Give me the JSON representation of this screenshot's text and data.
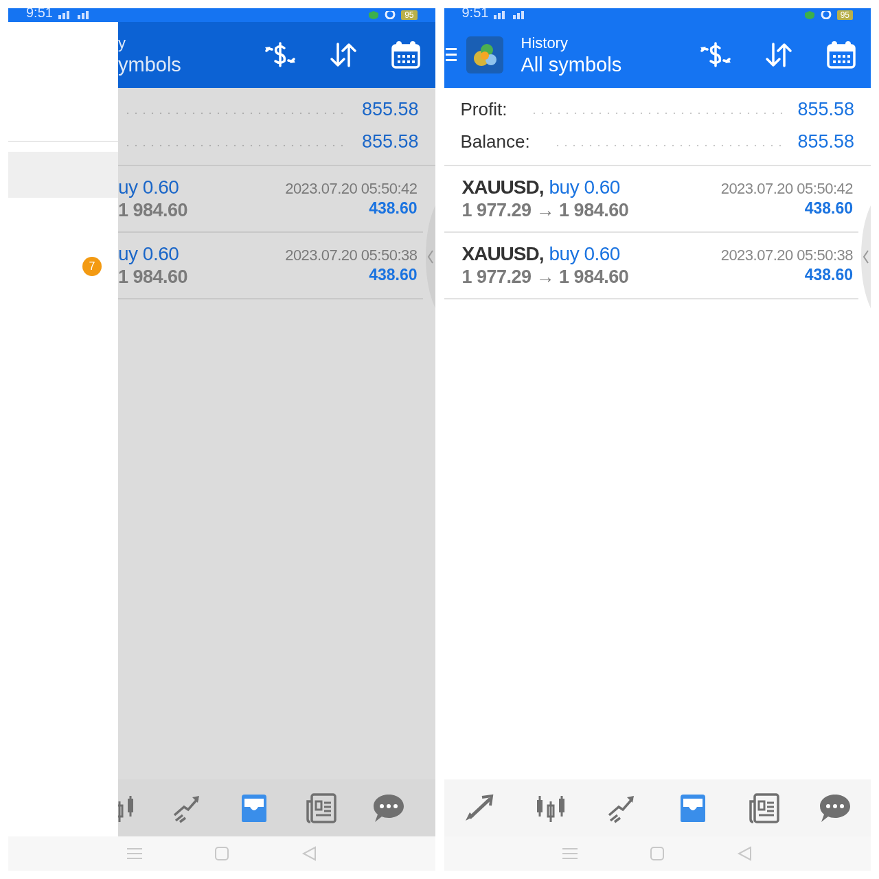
{
  "panels": [
    {
      "dimmed": true,
      "status_bar": {
        "time": "9:51",
        "battery": "95"
      },
      "drawer": {
        "badge": "7"
      },
      "header": {
        "title": "y",
        "subtitle": "ymbols"
      },
      "summary": [
        {
          "value": "855.58"
        },
        {
          "value": "855.58"
        }
      ],
      "deals": [
        {
          "side": "uy 0.60",
          "prices": "1 984.60",
          "time": "2023.07.20 05:50:42",
          "profit": "438.60"
        },
        {
          "side": "uy 0.60",
          "prices": "1 984.60",
          "time": "2023.07.20 05:50:38",
          "profit": "438.60"
        }
      ],
      "nav": [
        {
          "kind": "candles",
          "selected": false,
          "cut": true
        },
        {
          "kind": "chart",
          "selected": false
        },
        {
          "kind": "inbox",
          "selected": true
        },
        {
          "kind": "news",
          "selected": false
        },
        {
          "kind": "chat",
          "selected": false
        }
      ]
    },
    {
      "dimmed": false,
      "status_bar": {
        "time": "9:51",
        "battery": "95"
      },
      "header": {
        "menu": true,
        "logo": true,
        "title": "History",
        "subtitle": "All symbols"
      },
      "summary": [
        {
          "label": "Profit:",
          "value": "855.58"
        },
        {
          "label": "Balance:",
          "value": "855.58"
        }
      ],
      "deals": [
        {
          "symbol": "XAUUSD,",
          "side": "buy 0.60",
          "prices": "1 977.29 → 1 984.60",
          "time": "2023.07.20 05:50:42",
          "profit": "438.60"
        },
        {
          "symbol": "XAUUSD,",
          "side": "buy 0.60",
          "prices": "1 977.29 → 1 984.60",
          "time": "2023.07.20 05:50:38",
          "profit": "438.60"
        }
      ],
      "nav": [
        {
          "kind": "trade",
          "selected": false
        },
        {
          "kind": "candles",
          "selected": false
        },
        {
          "kind": "chart",
          "selected": false
        },
        {
          "kind": "inbox",
          "selected": true
        },
        {
          "kind": "news",
          "selected": false
        },
        {
          "kind": "chat",
          "selected": false
        }
      ]
    }
  ]
}
